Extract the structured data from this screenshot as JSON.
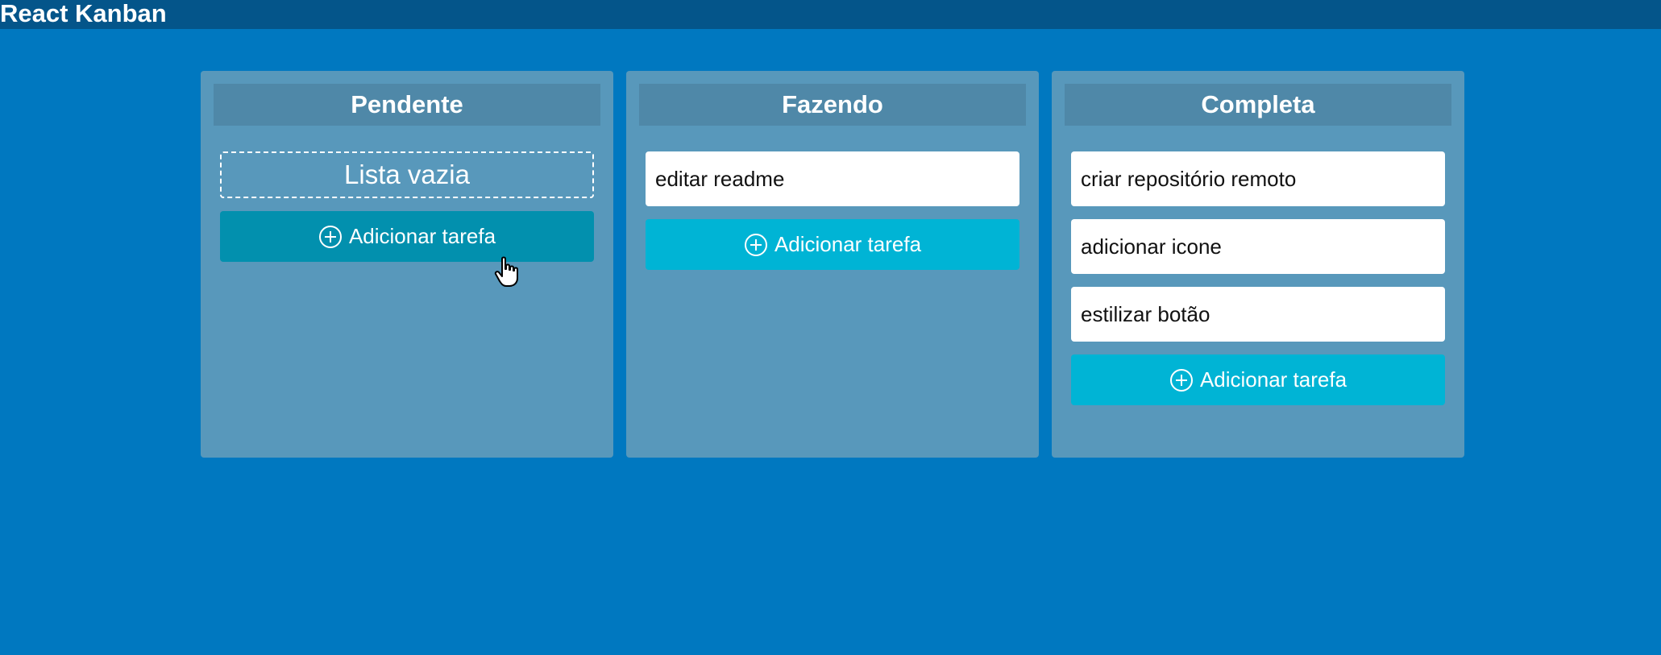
{
  "app": {
    "title": "React Kanban"
  },
  "columns": [
    {
      "title": "Pendente",
      "empty_text": "Lista vazia",
      "cards": [],
      "add_label": "Adicionar tarefa"
    },
    {
      "title": "Fazendo",
      "cards": [
        "editar readme"
      ],
      "add_label": "Adicionar tarefa"
    },
    {
      "title": "Completa",
      "cards": [
        "criar repositório remoto",
        "adicionar icone",
        "estilizar botão"
      ],
      "add_label": "Adicionar tarefa"
    }
  ],
  "colors": {
    "background": "#0078c0",
    "topbar": "#04558a",
    "column": "#5898bb",
    "column_header": "#4f88a8",
    "button": "#00b4d5",
    "button_hover": "#0290ae"
  },
  "icons": {
    "add": "plus-circle-icon",
    "cursor": "hand-pointer-cursor"
  }
}
